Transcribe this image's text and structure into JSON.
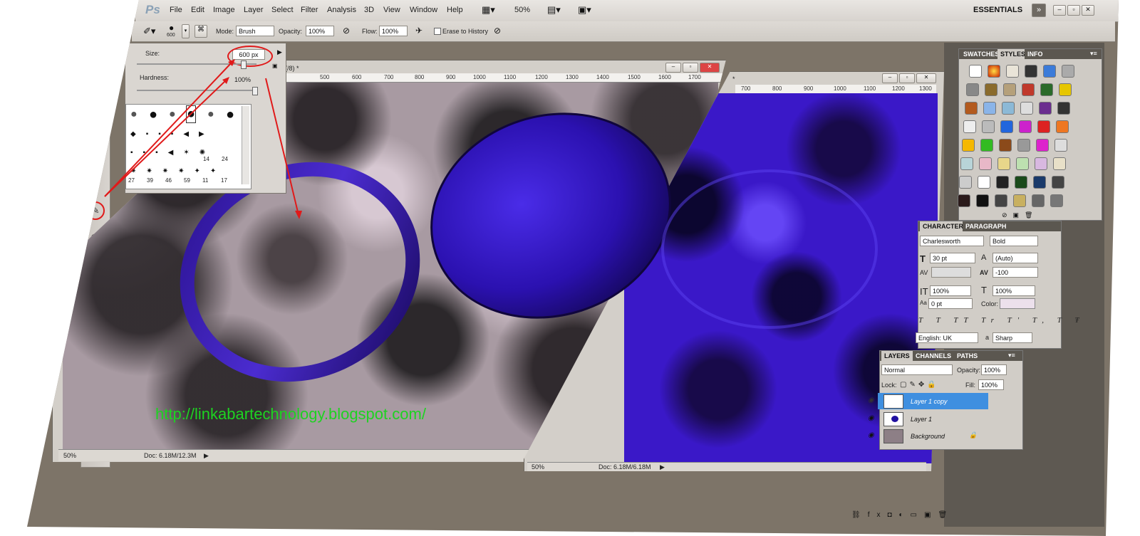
{
  "app": {
    "logo": "Ps",
    "workspace": "ESSENTIALS",
    "zoom_menu": "50%"
  },
  "menu": [
    "File",
    "Edit",
    "Image",
    "Layer",
    "Select",
    "Filter",
    "Analysis",
    "3D",
    "View",
    "Window",
    "Help"
  ],
  "options": {
    "brush_size_label": "600",
    "mode_label": "Mode:",
    "mode_value": "Brush",
    "opacity_label": "Opacity:",
    "opacity_value": "100%",
    "flow_label": "Flow:",
    "flow_value": "100%",
    "erase_history_label": "Erase to History"
  },
  "brush_popup": {
    "size_label": "Size:",
    "size_value": "600 px",
    "hardness_label": "Hardness:",
    "hardness_value": "100%",
    "size_fraction": 0.9,
    "hardness_fraction": 1.0,
    "presets_row4": [
      "27",
      "39",
      "46",
      "59",
      "11",
      "17"
    ],
    "presets_row3": [
      "14",
      "24"
    ]
  },
  "doc1": {
    "title": "(/8) *",
    "ruler": [
      "500",
      "600",
      "700",
      "800",
      "900",
      "1000",
      "1100",
      "1200",
      "1300",
      "1400",
      "1500",
      "1600",
      "1700"
    ],
    "status_zoom": "50%",
    "status_doc": "Doc: 6.18M/12.3M"
  },
  "doc2": {
    "title": "*",
    "ruler": [
      "700",
      "800",
      "900",
      "1000",
      "1100",
      "1200",
      "1300"
    ],
    "status_zoom": "50%",
    "status_doc": "Doc: 6.18M/6.18M"
  },
  "watermark": "http://linkabartechnology.blogspot.com/",
  "styles_panel": {
    "tabs": [
      "SWATCHES",
      "STYLES",
      "INFO"
    ],
    "active": "STYLES"
  },
  "character_panel": {
    "tabs": [
      "CHARACTER",
      "PARAGRAPH"
    ],
    "font_family": "Charlesworth",
    "font_style": "Bold",
    "font_size": "30 pt",
    "leading": "(Auto)",
    "tracking": "-100",
    "vscale": "100%",
    "hscale": "100%",
    "baseline": "0 pt",
    "color_label": "Color:",
    "language": "English: UK",
    "aa_label": "a",
    "antialias": "Sharp",
    "type_buttons": [
      "T",
      "T",
      "TT",
      "Tr",
      "T'",
      "T,",
      "T",
      "Ŧ"
    ]
  },
  "layers_panel": {
    "tabs": [
      "LAYERS",
      "CHANNELS",
      "PATHS"
    ],
    "blend_mode": "Normal",
    "opacity_label": "Opacity:",
    "opacity_value": "100%",
    "lock_label": "Lock:",
    "fill_label": "Fill:",
    "fill_value": "100%",
    "layers": [
      {
        "name": "Layer 1 copy",
        "selected": true
      },
      {
        "name": "Layer 1",
        "selected": false
      },
      {
        "name": "Background",
        "selected": false
      }
    ]
  },
  "colors": {
    "accent_red": "#e01a1a",
    "selected_layer": "#3f8fe0",
    "link_green": "#1dd321"
  }
}
